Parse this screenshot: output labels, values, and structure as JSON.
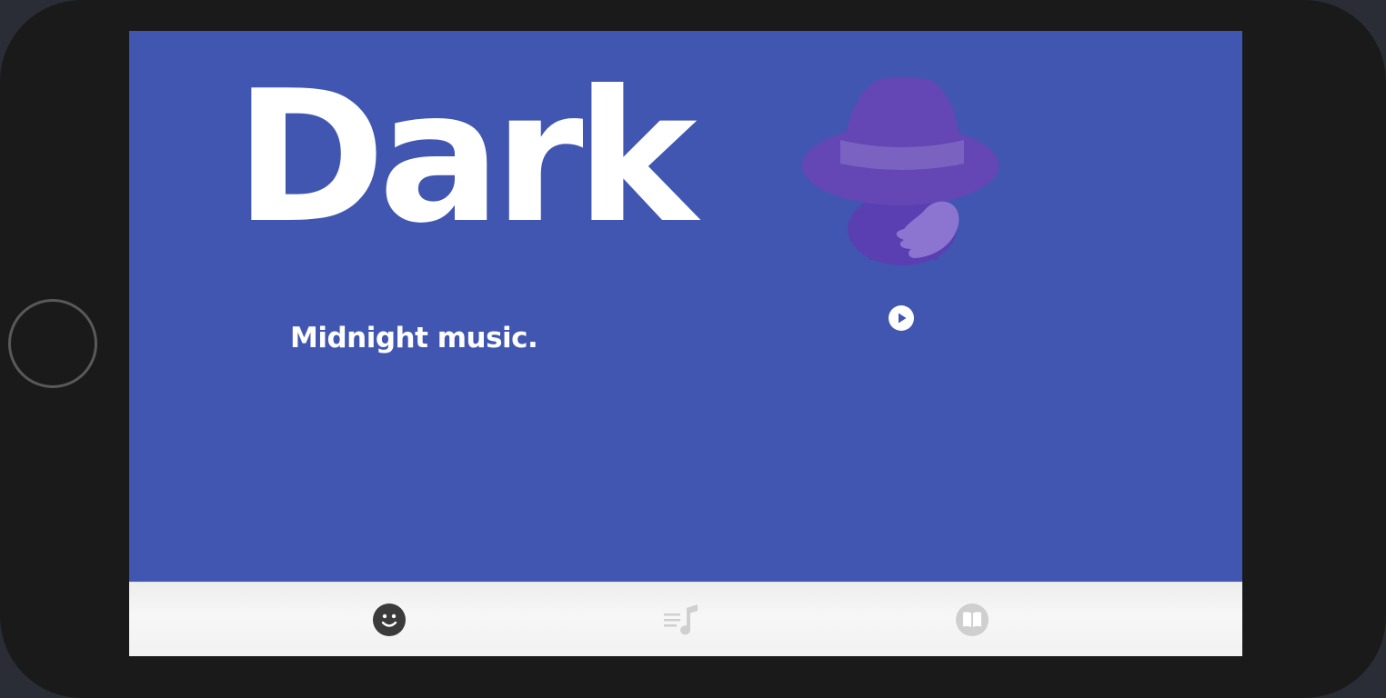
{
  "screen": {
    "title": "Dark",
    "subtitle": "Midnight music.",
    "background_color": "#4056b1"
  },
  "hero": {
    "icon": "detective-hat-icon",
    "colors": {
      "hat": "#6446b4",
      "band": "#7a63c0",
      "face": "#5a3fb2",
      "hand": "#8b75d0"
    }
  },
  "player": {
    "play_icon": "play-circle-icon"
  },
  "tabbar": {
    "tabs": [
      {
        "icon": "smiley-icon",
        "active": true
      },
      {
        "icon": "playlist-music-icon",
        "active": false
      },
      {
        "icon": "book-icon",
        "active": false
      }
    ],
    "active_color": "#3b3b3b",
    "inactive_color": "#cfcfcf"
  }
}
